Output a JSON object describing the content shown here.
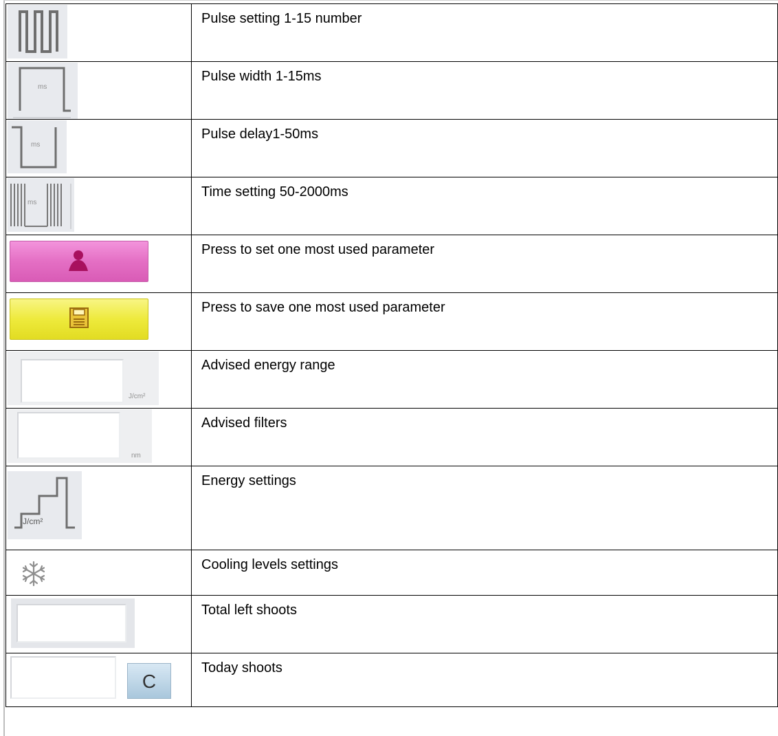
{
  "rows": [
    {
      "icon": "pulse-number-icon",
      "label": "Pulse setting 1-15 number"
    },
    {
      "icon": "pulse-width-icon",
      "label": "Pulse width 1-15ms",
      "unit": "ms"
    },
    {
      "icon": "pulse-delay-icon",
      "label": "Pulse delay1-50ms",
      "unit": "ms"
    },
    {
      "icon": "time-setting-icon",
      "label": "Time setting 50-2000ms",
      "unit": "ms"
    },
    {
      "icon": "user-icon",
      "label": "Press to set one most used parameter",
      "color": "#e46fc4"
    },
    {
      "icon": "floppy-disk-icon",
      "label": "Press to save one most used parameter",
      "color": "#eeea3c"
    },
    {
      "icon": "energy-range-field",
      "label": "Advised energy range",
      "unit": "J/cm²"
    },
    {
      "icon": "filter-field",
      "label": "Advised filters",
      "unit": "nm"
    },
    {
      "icon": "energy-steps-icon",
      "label": "Energy settings",
      "unit": "J/cm²"
    },
    {
      "icon": "snowflake-icon",
      "label": "Cooling levels settings"
    },
    {
      "icon": "shoots-field",
      "label": "Total left shoots"
    },
    {
      "icon": "today-shoots-field",
      "label": "Today shoots",
      "button": "C"
    }
  ]
}
